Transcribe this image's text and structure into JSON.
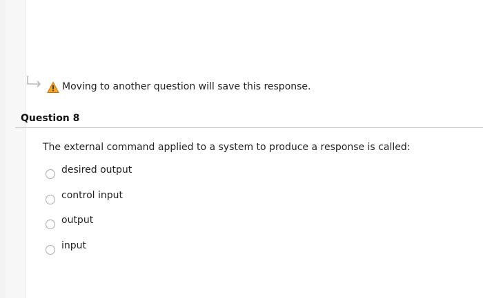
{
  "notice": {
    "icon": "warning-icon",
    "text": "Moving to another question will save this response."
  },
  "question": {
    "title": "Question 8",
    "text": "The external command applied to a system to produce a response is called:",
    "choices": [
      {
        "label": "desired output",
        "selected": false
      },
      {
        "label": "control input",
        "selected": false
      },
      {
        "label": "output",
        "selected": false
      },
      {
        "label": "input",
        "selected": false
      }
    ]
  },
  "colors": {
    "warning_fill": "#f5a623",
    "divider": "#c9c9c9",
    "radio_border": "#a8a8a8"
  }
}
